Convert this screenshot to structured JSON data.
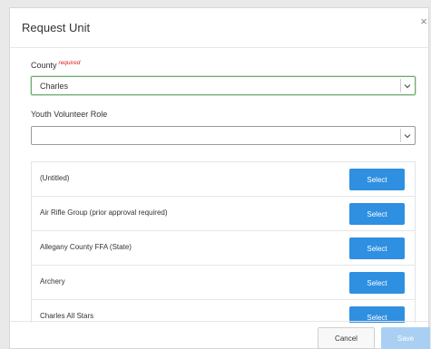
{
  "modal": {
    "title": "Request Unit",
    "close_glyph": "×"
  },
  "county": {
    "label": "County",
    "required_text": "required",
    "value": "Charles"
  },
  "role": {
    "label": "Youth Volunteer Role",
    "value": ""
  },
  "units": [
    {
      "name": "(Untitled)",
      "button": "Select"
    },
    {
      "name": "Air Rifle Group (prior approval required)",
      "button": "Select"
    },
    {
      "name": "Allegany County FFA (State)",
      "button": "Select"
    },
    {
      "name": "Archery",
      "button": "Select"
    },
    {
      "name": "Charles All Stars",
      "button": "Select"
    }
  ],
  "footer": {
    "cancel_label": "Cancel",
    "save_label": "Save"
  },
  "colors": {
    "select_button": "#2f8fe0",
    "save_button_disabled": "#a9d0f2",
    "required": "#e0201a",
    "focus_border": "#6ea96e"
  },
  "icons": {
    "close": "close-icon",
    "dropdown": "chevron-down-icon"
  }
}
